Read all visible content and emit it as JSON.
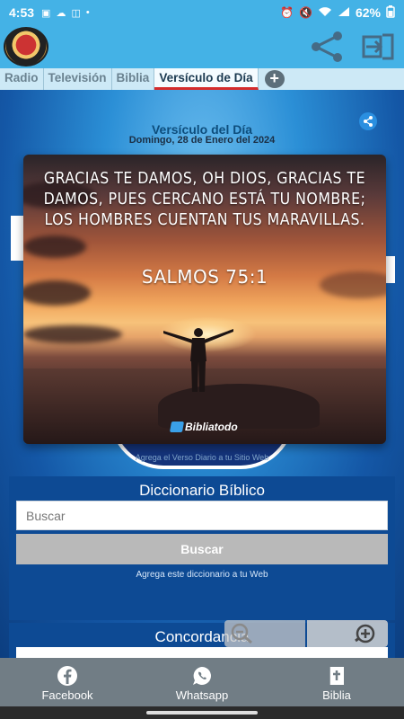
{
  "status_bar": {
    "time": "4:53",
    "battery": "62%"
  },
  "tabs": [
    {
      "label": "Radio",
      "active": false
    },
    {
      "label": "Televisión",
      "active": false
    },
    {
      "label": "Biblia",
      "active": false
    },
    {
      "label": "Versículo de Día",
      "active": true
    }
  ],
  "verse": {
    "heading": "Versículo del Día",
    "date": "Domingo, 28 de Enero del 2024",
    "text": "Gracias te damos, oh Dios, gracias te damos, pues cercano está tu nombre; los hombres cuentan tus maravillas.",
    "reference": "SALMOS 75:1",
    "brand": "Bibliatodo",
    "embed_note": "Agrega el Verso Diario a tu Sitio Web"
  },
  "dictionary": {
    "title": "Diccionario Bíblico",
    "placeholder": "Buscar",
    "button": "Buscar",
    "note": "Agrega este diccionario a tu Web"
  },
  "concordance": {
    "title": "Concordancia"
  },
  "bottom_nav": [
    {
      "label": "Facebook",
      "icon": "facebook-icon"
    },
    {
      "label": "Whatsapp",
      "icon": "whatsapp-icon"
    },
    {
      "label": "Biblia",
      "icon": "bible-icon"
    }
  ],
  "colors": {
    "appbar": "#44b2e6",
    "active_tab_underline": "#d52b2b",
    "panel": "#0d4a94",
    "bottom_nav": "#717d85"
  }
}
